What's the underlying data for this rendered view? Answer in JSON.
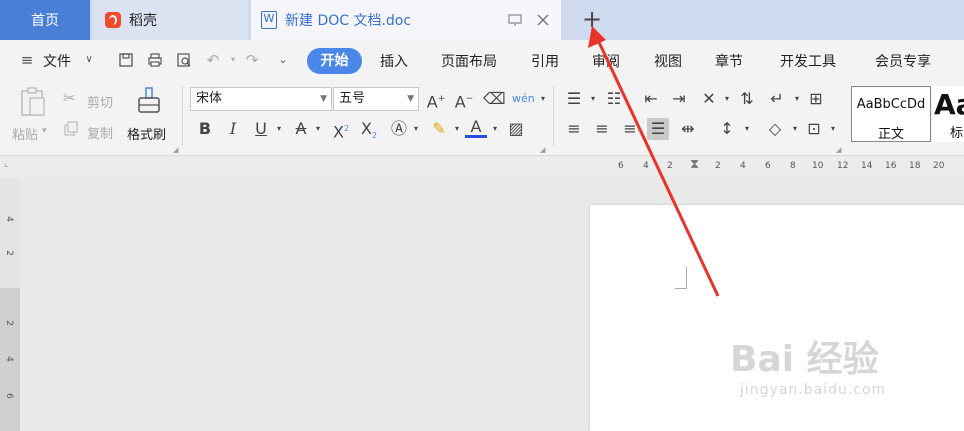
{
  "tabs": {
    "home": "首页",
    "daoke": "稻壳",
    "doc": "新建 DOC 文档.doc"
  },
  "menu": {
    "file": "文件",
    "items": [
      "开始",
      "插入",
      "页面布局",
      "引用",
      "审阅",
      "视图",
      "章节",
      "开发工具",
      "会员专享"
    ]
  },
  "ribbon": {
    "paste": "粘贴",
    "cut": "剪切",
    "copy": "复制",
    "format_painter": "格式刷",
    "font": "宋体",
    "size": "五号",
    "style1_sample": "AaBbCcDd",
    "style1_name": "正文",
    "style2_sample": "Aa",
    "style2_name": "标"
  },
  "ruler": {
    "h_numbers": [
      "6",
      "4",
      "2",
      "2",
      "4",
      "6",
      "8",
      "10",
      "12",
      "14",
      "16",
      "18",
      "20"
    ],
    "v_numbers": [
      "4",
      "2",
      "2",
      "4",
      "6"
    ]
  },
  "watermark": {
    "brand": "Bai 经验",
    "url": "jingyan.baidu.com"
  },
  "colors": {
    "accent": "#4a87e8",
    "arrow": "#e8322a"
  }
}
